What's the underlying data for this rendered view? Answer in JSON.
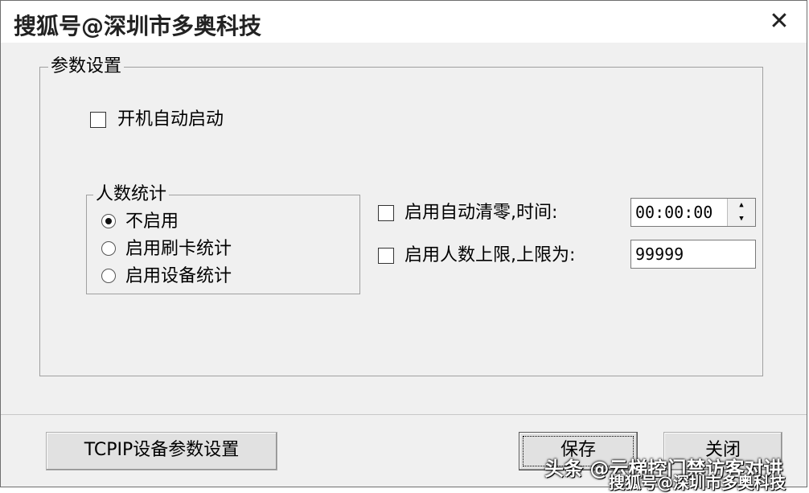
{
  "window": {
    "title": "搜狐号@深圳市多奥科技",
    "close_glyph": "✕"
  },
  "params_group": {
    "legend": "参数设置",
    "autostart_label": "开机自动启动",
    "autostart_checked": false
  },
  "people_count": {
    "legend": "人数统计",
    "options": [
      {
        "label": "不启用",
        "selected": true
      },
      {
        "label": "启用刷卡统计",
        "selected": false
      },
      {
        "label": "启用设备统计",
        "selected": false
      }
    ]
  },
  "auto_clear": {
    "label": "启用自动清零,时间:",
    "checked": false,
    "time_value": "00:00:00"
  },
  "people_limit": {
    "label": "启用人数上限,上限为:",
    "checked": false,
    "limit_value": "99999"
  },
  "footer": {
    "tcpip_button": "TCPIP设备参数设置",
    "save_button": "保存",
    "close_button": "关闭"
  },
  "watermarks": {
    "line1": "头条 @云梯控门禁访客对讲",
    "line2": "搜狐号@深圳市多奥科技"
  }
}
